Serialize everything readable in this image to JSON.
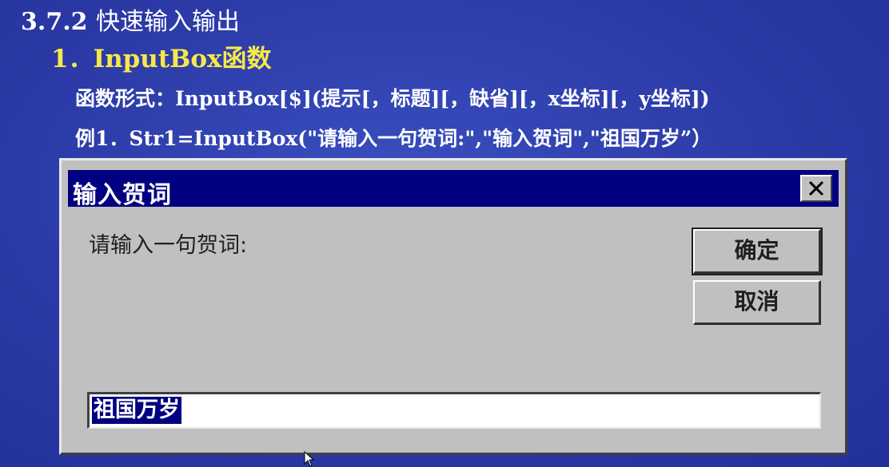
{
  "slide": {
    "heading_num": "3.7.2",
    "heading_text": "快速输入输出",
    "subheading": "1．InputBox函数",
    "syntax": "函数形式：InputBox[$](提示[，标题][，缺省][，x坐标][，y坐标])",
    "example": "例1．Str1=InputBox(\"请输入一句贺词:\",\"输入贺词\",\"祖国万岁”）"
  },
  "dialog": {
    "title": "输入贺词",
    "prompt": "请输入一句贺词:",
    "ok_label": "确定",
    "cancel_label": "取消",
    "input_value": "祖国万岁",
    "close_icon": "close-icon"
  },
  "colors": {
    "slide_background": "#2b3aa6",
    "heading": "#ffffff",
    "subheading": "#f7e84a",
    "titlebar": "#000080",
    "dialog_face": "#c0c0c0",
    "selection": "#000080"
  }
}
